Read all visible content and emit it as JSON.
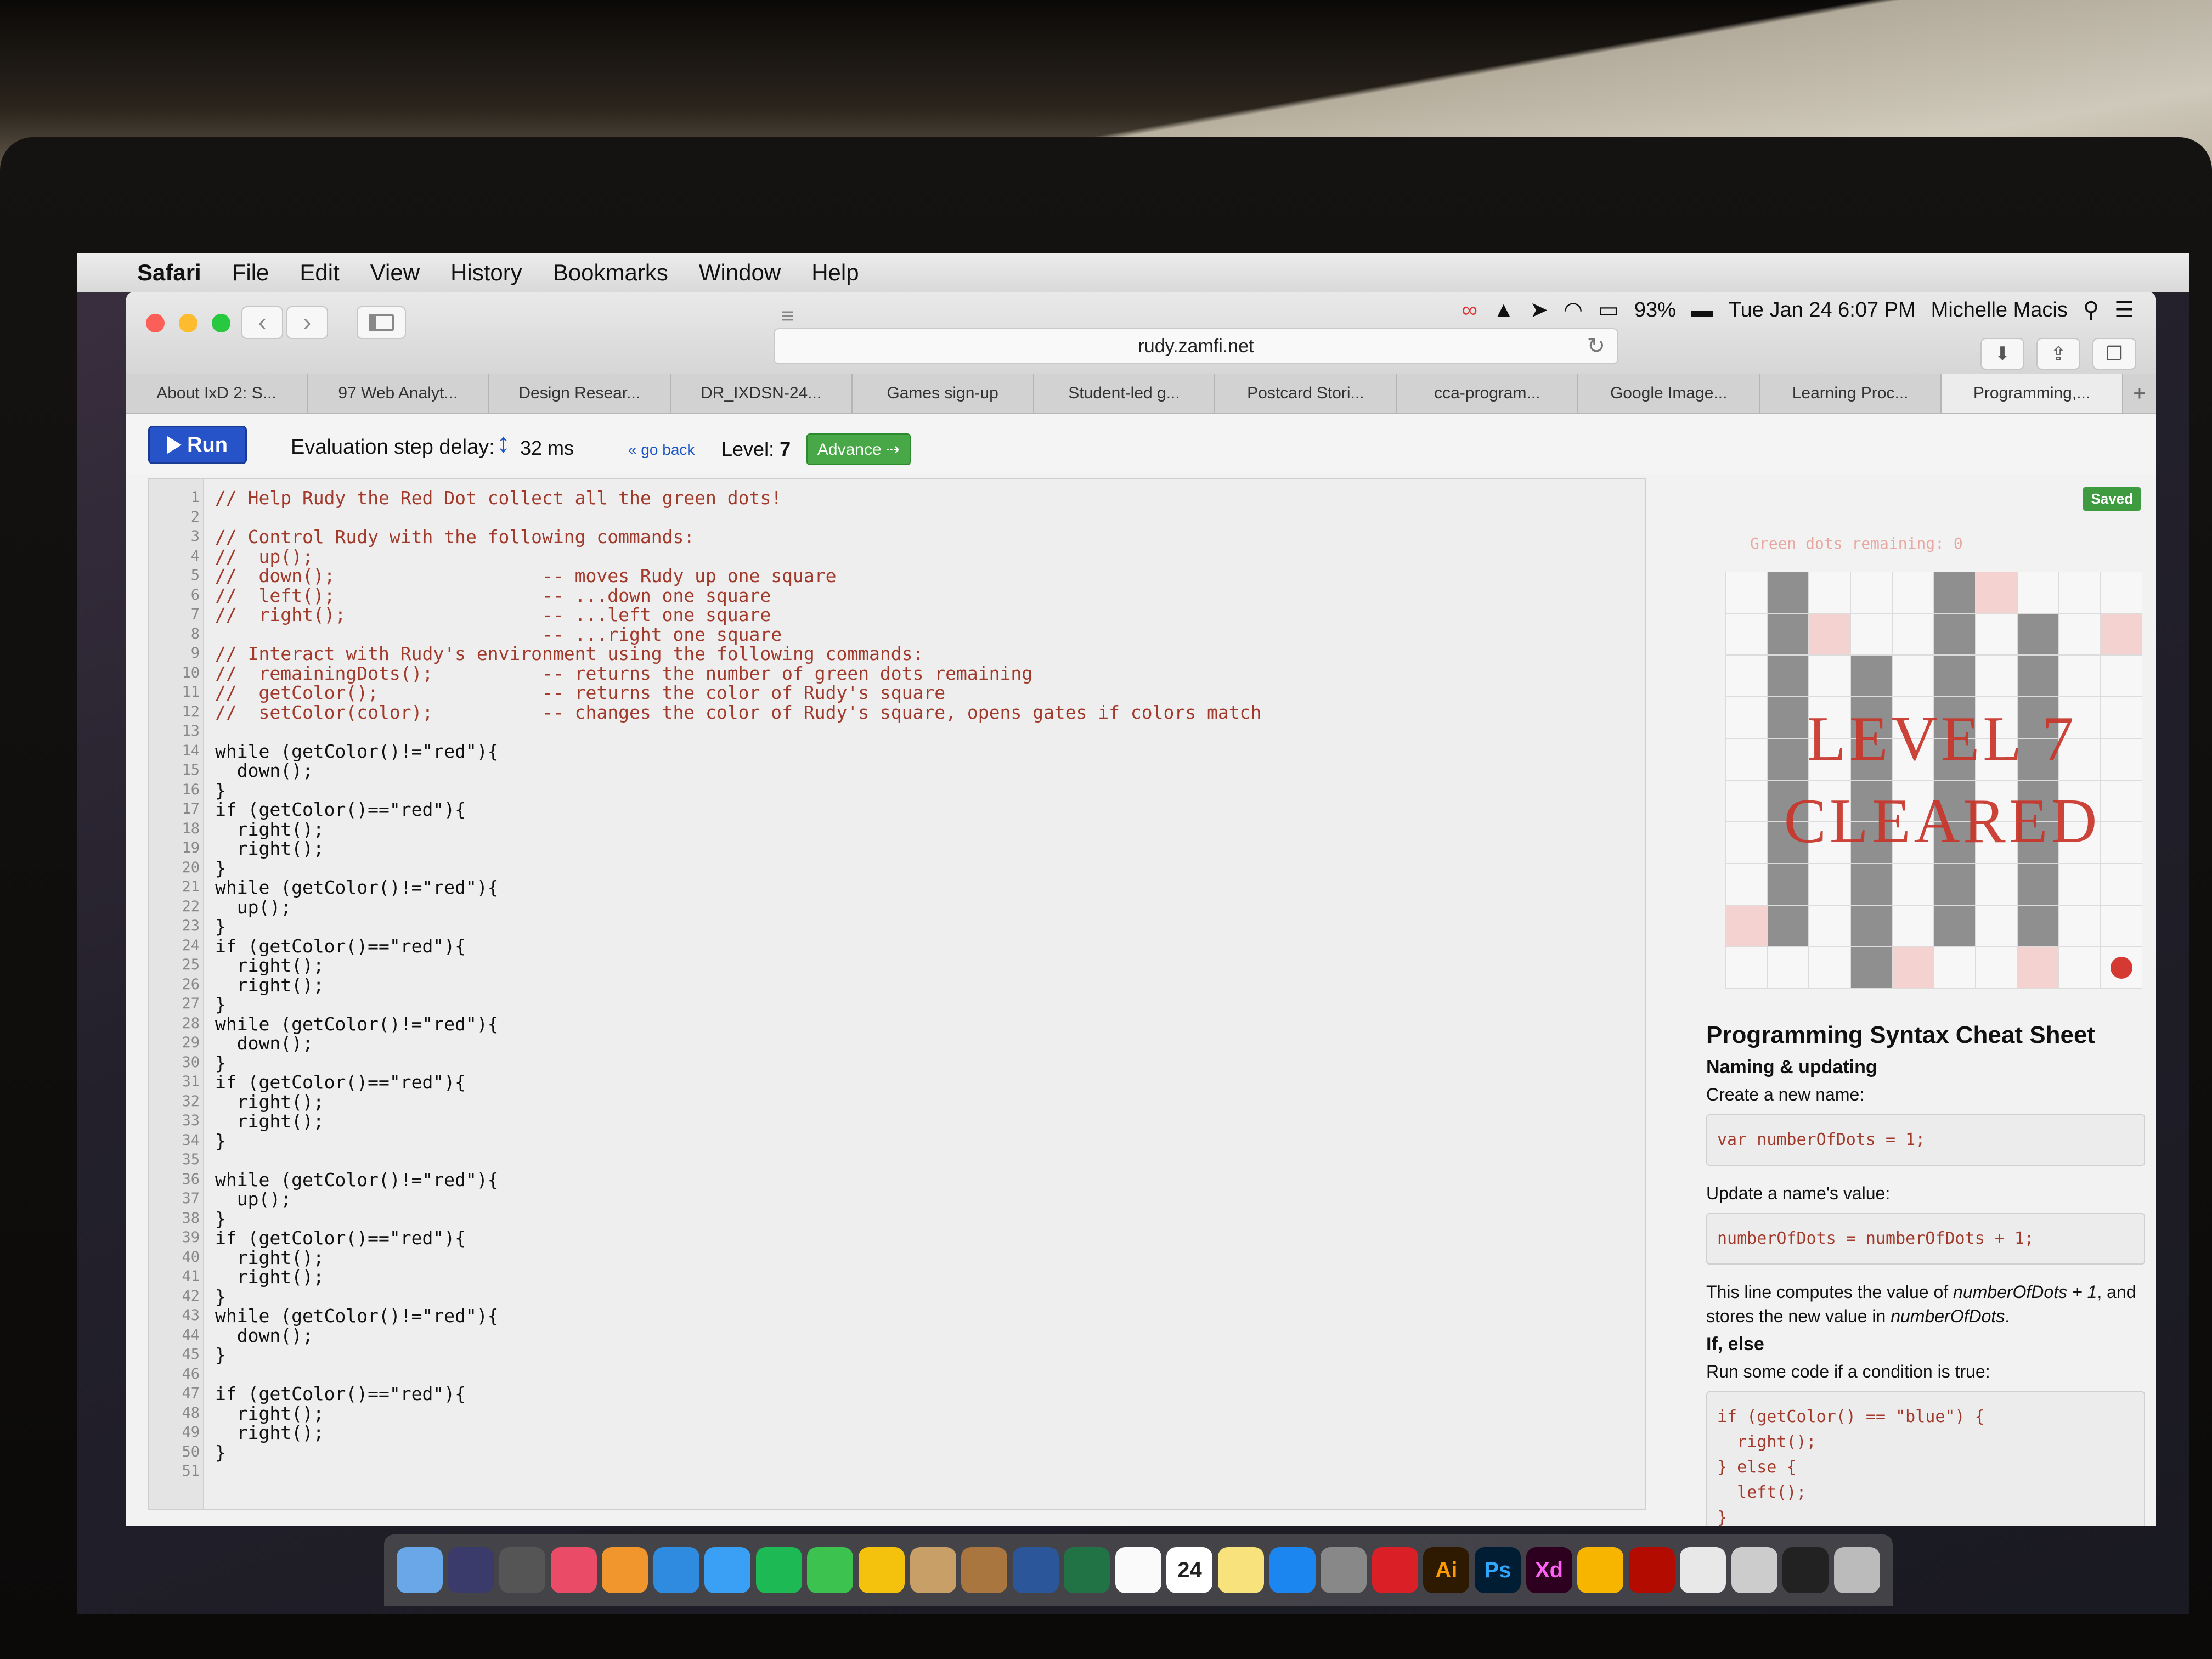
{
  "menubar": {
    "app": "Safari",
    "items": [
      "File",
      "Edit",
      "View",
      "History",
      "Bookmarks",
      "Window",
      "Help"
    ]
  },
  "status": {
    "battery": "93%",
    "datetime": "Tue Jan 24  6:07 PM",
    "user": "Michelle Macis"
  },
  "browser": {
    "url": "rudy.zamfi.net",
    "tabs": [
      "About IxD 2: S...",
      "97 Web Analyt...",
      "Design Resear...",
      "DR_IXDSN-24...",
      "Games sign-up",
      "Student-led g...",
      "Postcard Stori...",
      "cca-program...",
      "Google Image...",
      "Learning Proc...",
      "Programming,..."
    ],
    "new_tab": "+"
  },
  "app": {
    "run_label": "Run",
    "delay_label": "Evaluation step delay:",
    "delay_value": "32 ms",
    "go_back": "« go back",
    "level_label": "Level:",
    "level_value": "7",
    "advance_label": "Advance ⇢",
    "saved": "Saved"
  },
  "editor": {
    "lines": [
      {
        "n": "1",
        "t": "// Help Rudy the Red Dot collect all the green dots!",
        "c": true
      },
      {
        "n": "2",
        "t": "",
        "c": false
      },
      {
        "n": "3",
        "t": "// Control Rudy with the following commands:",
        "c": true
      },
      {
        "n": "4",
        "t": "//  up();",
        "c": true
      },
      {
        "n": "5",
        "t": "//  down();                   -- moves Rudy up one square",
        "c": true
      },
      {
        "n": "6",
        "t": "//  left();                   -- ...down one square",
        "c": true
      },
      {
        "n": "7",
        "t": "//  right();                  -- ...left one square",
        "c": true
      },
      {
        "n": "8",
        "t": "                              -- ...right one square",
        "c": true
      },
      {
        "n": "9",
        "t": "// Interact with Rudy's environment using the following commands:",
        "c": true
      },
      {
        "n": "10",
        "t": "//  remainingDots();          -- returns the number of green dots remaining",
        "c": true
      },
      {
        "n": "11",
        "t": "//  getColor();               -- returns the color of Rudy's square",
        "c": true
      },
      {
        "n": "12",
        "t": "//  setColor(color);          -- changes the color of Rudy's square, opens gates if colors match",
        "c": true
      },
      {
        "n": "13",
        "t": "",
        "c": false
      },
      {
        "n": "14",
        "t": "while (getColor()!=\"red\"){",
        "c": false
      },
      {
        "n": "15",
        "t": "  down();",
        "c": false
      },
      {
        "n": "16",
        "t": "}",
        "c": false
      },
      {
        "n": "17",
        "t": "if (getColor()==\"red\"){",
        "c": false
      },
      {
        "n": "18",
        "t": "  right();",
        "c": false
      },
      {
        "n": "19",
        "t": "  right();",
        "c": false
      },
      {
        "n": "20",
        "t": "}",
        "c": false
      },
      {
        "n": "21",
        "t": "while (getColor()!=\"red\"){",
        "c": false
      },
      {
        "n": "22",
        "t": "  up();",
        "c": false
      },
      {
        "n": "23",
        "t": "}",
        "c": false
      },
      {
        "n": "24",
        "t": "if (getColor()==\"red\"){",
        "c": false
      },
      {
        "n": "25",
        "t": "  right();",
        "c": false
      },
      {
        "n": "26",
        "t": "  right();",
        "c": false
      },
      {
        "n": "27",
        "t": "}",
        "c": false
      },
      {
        "n": "28",
        "t": "while (getColor()!=\"red\"){",
        "c": false
      },
      {
        "n": "29",
        "t": "  down();",
        "c": false
      },
      {
        "n": "30",
        "t": "}",
        "c": false
      },
      {
        "n": "31",
        "t": "if (getColor()==\"red\"){",
        "c": false
      },
      {
        "n": "32",
        "t": "  right();",
        "c": false
      },
      {
        "n": "33",
        "t": "  right();",
        "c": false
      },
      {
        "n": "34",
        "t": "}",
        "c": false
      },
      {
        "n": "35",
        "t": "",
        "c": false
      },
      {
        "n": "36",
        "t": "while (getColor()!=\"red\"){",
        "c": false
      },
      {
        "n": "37",
        "t": "  up();",
        "c": false
      },
      {
        "n": "38",
        "t": "}",
        "c": false
      },
      {
        "n": "39",
        "t": "if (getColor()==\"red\"){",
        "c": false
      },
      {
        "n": "40",
        "t": "  right();",
        "c": false
      },
      {
        "n": "41",
        "t": "  right();",
        "c": false
      },
      {
        "n": "42",
        "t": "}",
        "c": false
      },
      {
        "n": "43",
        "t": "while (getColor()!=\"red\"){",
        "c": false
      },
      {
        "n": "44",
        "t": "  down();",
        "c": false
      },
      {
        "n": "45",
        "t": "}",
        "c": false
      },
      {
        "n": "46",
        "t": "",
        "c": false
      },
      {
        "n": "47",
        "t": "if (getColor()==\"red\"){",
        "c": false
      },
      {
        "n": "48",
        "t": "  right();",
        "c": false
      },
      {
        "n": "49",
        "t": "  right();",
        "c": false
      },
      {
        "n": "50",
        "t": "}",
        "c": false
      },
      {
        "n": "51",
        "t": "",
        "c": false
      }
    ]
  },
  "game": {
    "green_remaining": "Green dots remaining: 0",
    "cleared_line1": "LEVEL 7",
    "cleared_line2": "CLEARED",
    "colors": {
      "wall": "#8f8f8f",
      "empty": "#f7f7f7",
      "red_square": "#f3d2cf",
      "rudy": "#d43a32"
    }
  },
  "cheatsheet": {
    "title": "Programming Syntax Cheat Sheet",
    "naming_heading": "Naming & updating",
    "create_text": "Create a new name:",
    "create_code": "var numberOfDots = 1;",
    "update_text": "Update a name's value:",
    "update_code": "numberOfDots = numberOfDots + 1;",
    "explain_prefix": "This line computes the value of ",
    "explain_expr": "numberOfDots + 1",
    "explain_mid": ", and stores the new value in ",
    "explain_var": "numberOfDots",
    "explain_end": ".",
    "ifelse_heading": "If, else",
    "ifelse_text": "Run some code if a condition is true:",
    "ifelse_code": "if (getColor() == \"blue\") {\n  right();\n} else {\n  left();\n}"
  },
  "dock": {
    "items": [
      "finder",
      "siri",
      "launchpad",
      "itunes",
      "ibooks",
      "safari",
      "messages",
      "spotify",
      "facetime",
      "drive",
      "photos",
      "contacts",
      "word",
      "excel",
      "reminders",
      "calendar",
      "notes",
      "app-store",
      "preferences",
      "creative-cloud",
      "illustrator",
      "photoshop",
      "xd",
      "sketch",
      "acrobat",
      "preview",
      "screenshot",
      "terminal",
      "trash"
    ],
    "calendar_day": "24",
    "ai": "Ai",
    "ps": "Ps",
    "xd": "Xd"
  }
}
